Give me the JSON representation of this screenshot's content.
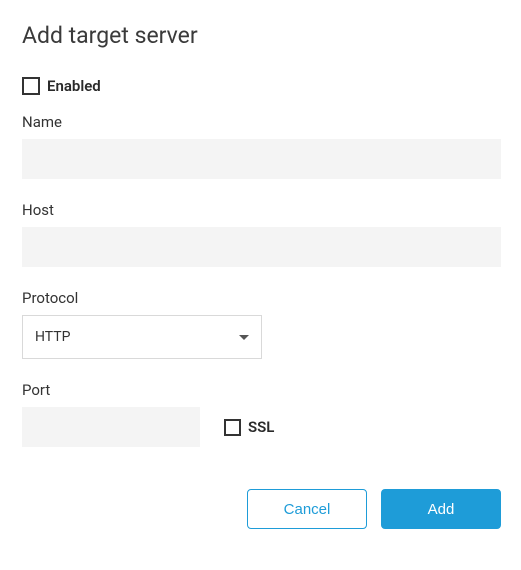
{
  "dialog": {
    "title": "Add target server"
  },
  "enabled": {
    "label": "Enabled",
    "checked": false
  },
  "fields": {
    "name": {
      "label": "Name",
      "value": ""
    },
    "host": {
      "label": "Host",
      "value": ""
    },
    "protocol": {
      "label": "Protocol",
      "value": "HTTP"
    },
    "port": {
      "label": "Port",
      "value": ""
    },
    "ssl": {
      "label": "SSL",
      "checked": false
    }
  },
  "buttons": {
    "cancel": "Cancel",
    "add": "Add"
  }
}
